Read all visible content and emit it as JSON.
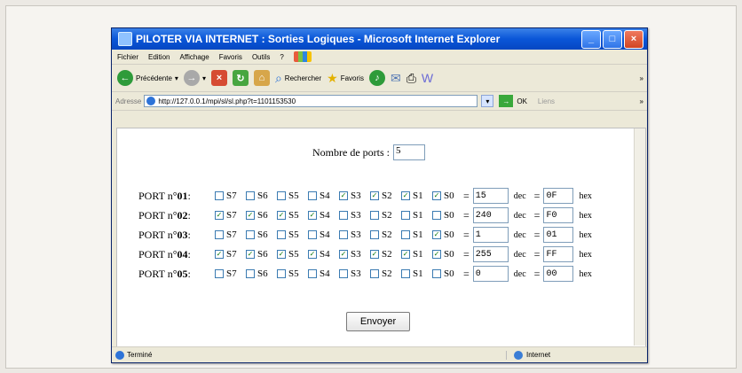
{
  "window": {
    "title": "PILOTER VIA INTERNET : Sorties Logiques - Microsoft Internet Explorer"
  },
  "menu": [
    "Fichier",
    "Edition",
    "Affichage",
    "Favoris",
    "Outils",
    "?"
  ],
  "toolbar": {
    "back": "Précédente",
    "search": "Rechercher",
    "favorites": "Favoris",
    "chevron": "»"
  },
  "address": {
    "label": "Adresse",
    "url": "http://127.0.0.1/mpi/sl/sl.php?t=1101153530",
    "go": "OK",
    "links": "Liens",
    "chevron": "»"
  },
  "page": {
    "ports_label": "Nombre de ports :",
    "ports_value": "5",
    "submit": "Envoyer"
  },
  "ports": [
    {
      "label": "PORT n°",
      "num": "01",
      "checks": [
        false,
        false,
        false,
        false,
        true,
        true,
        true,
        true
      ],
      "dec": "15",
      "hex": "0F"
    },
    {
      "label": "PORT n°",
      "num": "02",
      "checks": [
        true,
        true,
        true,
        true,
        false,
        false,
        false,
        false
      ],
      "dec": "240",
      "hex": "F0"
    },
    {
      "label": "PORT n°",
      "num": "03",
      "checks": [
        false,
        false,
        false,
        false,
        false,
        false,
        false,
        true
      ],
      "dec": "1",
      "hex": "01"
    },
    {
      "label": "PORT n°",
      "num": "04",
      "checks": [
        true,
        true,
        true,
        true,
        true,
        true,
        true,
        true
      ],
      "dec": "255",
      "hex": "FF"
    },
    {
      "label": "PORT n°",
      "num": "05",
      "checks": [
        false,
        false,
        false,
        false,
        false,
        false,
        false,
        false
      ],
      "dec": "0",
      "hex": "00"
    }
  ],
  "bits": [
    "S7",
    "S6",
    "S5",
    "S4",
    "S3",
    "S2",
    "S1",
    "S0"
  ],
  "units": {
    "dec": "dec",
    "hex": "hex"
  },
  "status": {
    "left": "Terminé",
    "right": "Internet"
  }
}
